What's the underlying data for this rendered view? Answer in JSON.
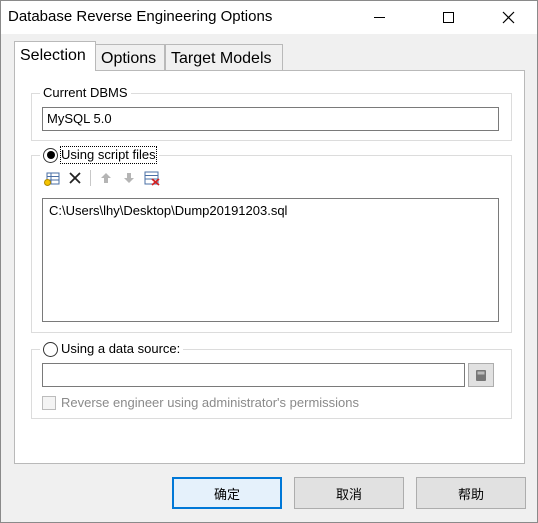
{
  "window": {
    "title": "Database Reverse Engineering Options"
  },
  "tabs": [
    {
      "label": "Selection"
    },
    {
      "label": "Options"
    },
    {
      "label": "Target Models"
    }
  ],
  "current_dbms": {
    "group_label": "Current DBMS",
    "value": "MySQL 5.0"
  },
  "script_files": {
    "radio_label": "Using script files",
    "selected": true,
    "toolbar": [
      "add-files-icon",
      "delete-icon",
      "move-up-icon",
      "move-down-icon",
      "clear-all-icon"
    ],
    "files": [
      "C:\\Users\\lhy\\Desktop\\Dump20191203.sql"
    ]
  },
  "data_source": {
    "radio_label": "Using a data source:",
    "selected": false,
    "value": "",
    "checkbox_label": "Reverse engineer using administrator's permissions",
    "checkbox_enabled": false
  },
  "buttons": {
    "ok": "确定",
    "cancel": "取消",
    "help": "帮助"
  }
}
